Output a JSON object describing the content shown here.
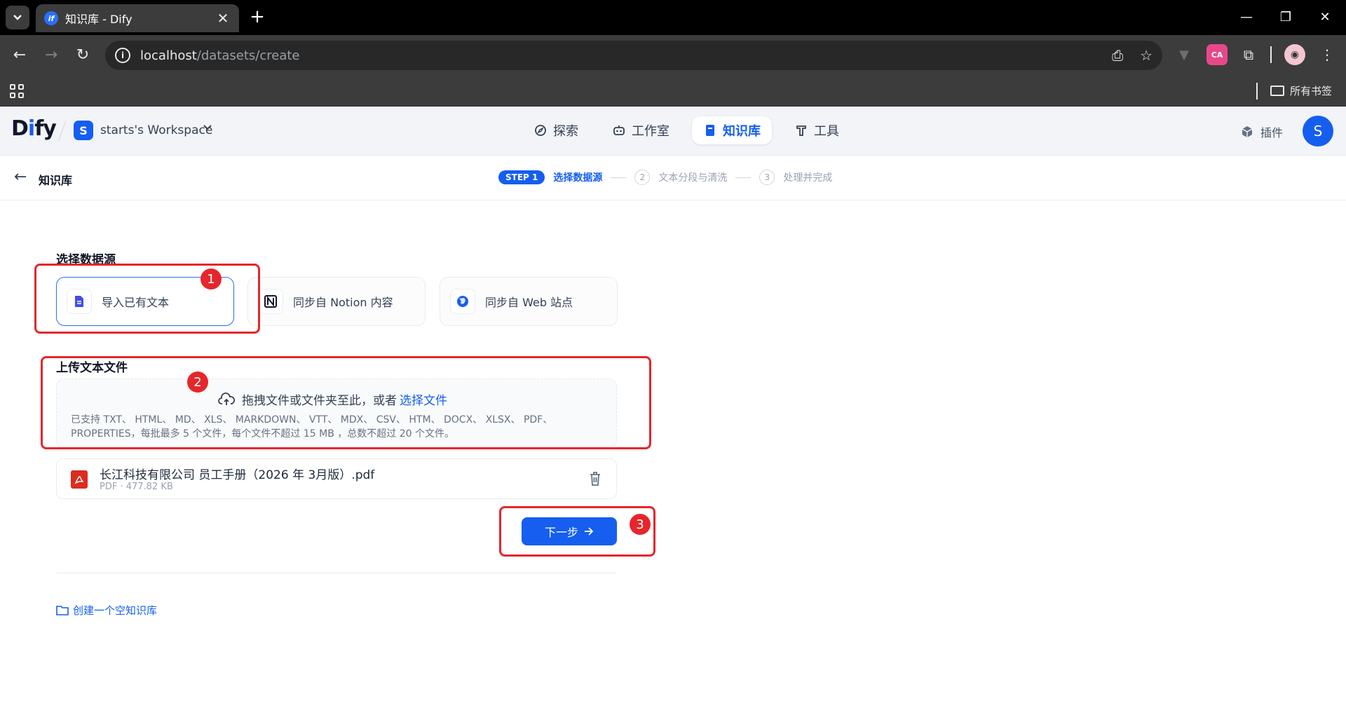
{
  "browser": {
    "tab_title": "知识库 - Dify",
    "tab_favicon_text": "if",
    "url_host": "localhost",
    "url_path": "/datasets/create",
    "bookmark_folder": "所有书签",
    "ext_badge_text": "CA"
  },
  "header": {
    "logo_prefix": "D",
    "logo_i": "i",
    "logo_suffix": "fy",
    "workspace_initial": "S",
    "workspace_name": "starts's Workspace",
    "nav": [
      {
        "label": "探索",
        "icon": "compass-icon",
        "active": false
      },
      {
        "label": "工作室",
        "icon": "robot-icon",
        "active": false
      },
      {
        "label": "知识库",
        "icon": "book-icon",
        "active": true
      },
      {
        "label": "工具",
        "icon": "hammer-icon",
        "active": false
      }
    ],
    "plugin_label": "插件",
    "avatar_initial": "S"
  },
  "subheader": {
    "back_label": "知识库",
    "step_badge": "STEP 1",
    "step1_label": "选择数据源",
    "step2_num": "2",
    "step2_label": "文本分段与清洗",
    "step3_num": "3",
    "step3_label": "处理并完成"
  },
  "main": {
    "datasource_title": "选择数据源",
    "datasources": [
      {
        "label": "导入已有文本",
        "selected": true
      },
      {
        "label": "同步自 Notion 内容",
        "selected": false
      },
      {
        "label": "同步自 Web 站点",
        "selected": false
      }
    ],
    "upload_title": "上传文本文件",
    "upload_prompt": "拖拽文件或文件夹至此，或者",
    "upload_link": "选择文件",
    "upload_hint_1": "已支持 TXT、 HTML、 MD、 XLS、 MARKDOWN、 VTT、 MDX、 CSV、 HTM、 DOCX、 XLSX、 PDF、",
    "upload_hint_2": "PROPERTIES，每批最多 5 个文件，每个文件不超过 15 MB ，总数不超过 20 个文件。",
    "file": {
      "name": "长江科技有限公司 员工手册（2026 年 3月版）.pdf",
      "meta": "PDF · 477.82 KB"
    },
    "next_label": "下一步",
    "empty_kb_label": "创建一个空知识库"
  },
  "annotations": [
    "1",
    "2",
    "3"
  ],
  "colors": {
    "accent": "#155eef",
    "annotation": "#e5262b"
  }
}
